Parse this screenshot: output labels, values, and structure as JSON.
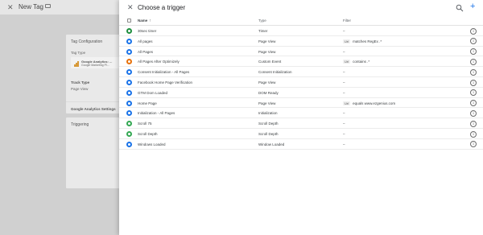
{
  "background": {
    "close_glyph": "✕",
    "title": "New Tag",
    "tag_configuration_label": "Tag Configuration",
    "tag_type_label": "Tag Type",
    "tag_name": "Google Analytics: ...",
    "tag_sub": "Google Marketing Pl...",
    "track_type_label": "Track Type",
    "track_type_value": "Page View",
    "settings_label": "Google Analytics Settings",
    "triggering_label": "Triggering"
  },
  "panel": {
    "close_glyph": "✕",
    "title": "Choose a trigger",
    "add_glyph": "+",
    "columns": {
      "name": "Name",
      "sort_glyph": "↑",
      "type": "Type",
      "filter": "Filter"
    },
    "info_glyph": "i"
  },
  "icons": {
    "timer": "#1e8e3e",
    "pageview": "#1a73e8",
    "custom": "#e8710a",
    "consent": "#1a73e8",
    "dom": "#1a73e8",
    "init": "#1a73e8",
    "scroll": "#34a853",
    "window": "#1a73e8"
  },
  "rows": [
    {
      "name": "30sec timer",
      "type": "Timer",
      "filter_chip": "",
      "filter_text": "–",
      "icon": "timer-icon",
      "color": "#1e8e3e"
    },
    {
      "name": "All pages",
      "type": "Page View",
      "filter_chip": "Url",
      "filter_text": "matches RegEx .*",
      "icon": "pageview-icon",
      "color": "#1a73e8"
    },
    {
      "name": "All Pages",
      "type": "Page View",
      "filter_chip": "",
      "filter_text": "–",
      "icon": "pageview-icon",
      "color": "#1a73e8"
    },
    {
      "name": "All Pages After Optimizely",
      "type": "Custom Event",
      "filter_chip": "Url",
      "filter_text": "contains .*",
      "icon": "custom-event-icon",
      "color": "#e8710a"
    },
    {
      "name": "Consent Initialization - All Pages",
      "type": "Consent Initialization",
      "filter_chip": "",
      "filter_text": "–",
      "icon": "consent-icon",
      "color": "#1a73e8"
    },
    {
      "name": "Facebook Home Page Verification",
      "type": "Page View",
      "filter_chip": "",
      "filter_text": "–",
      "icon": "pageview-icon",
      "color": "#1a73e8"
    },
    {
      "name": "GTM Dom Loaded",
      "type": "DOM Ready",
      "filter_chip": "",
      "filter_text": "–",
      "icon": "dom-ready-icon",
      "color": "#1a73e8"
    },
    {
      "name": "Home Page",
      "type": "Page View",
      "filter_chip": "Url",
      "filter_text": "equals www.ezgenius.com",
      "icon": "pageview-icon",
      "color": "#1a73e8"
    },
    {
      "name": "Initialization - All Pages",
      "type": "Initialization",
      "filter_chip": "",
      "filter_text": "–",
      "icon": "initialization-icon",
      "color": "#1a73e8"
    },
    {
      "name": "Scroll 75",
      "type": "Scroll Depth",
      "filter_chip": "",
      "filter_text": "–",
      "icon": "scroll-depth-icon",
      "color": "#34a853"
    },
    {
      "name": "Scroll Depth",
      "type": "Scroll Depth",
      "filter_chip": "",
      "filter_text": "–",
      "icon": "scroll-depth-icon",
      "color": "#34a853"
    },
    {
      "name": "Windows Loaded",
      "type": "Window Loaded",
      "filter_chip": "",
      "filter_text": "–",
      "icon": "window-loaded-icon",
      "color": "#1a73e8"
    }
  ]
}
